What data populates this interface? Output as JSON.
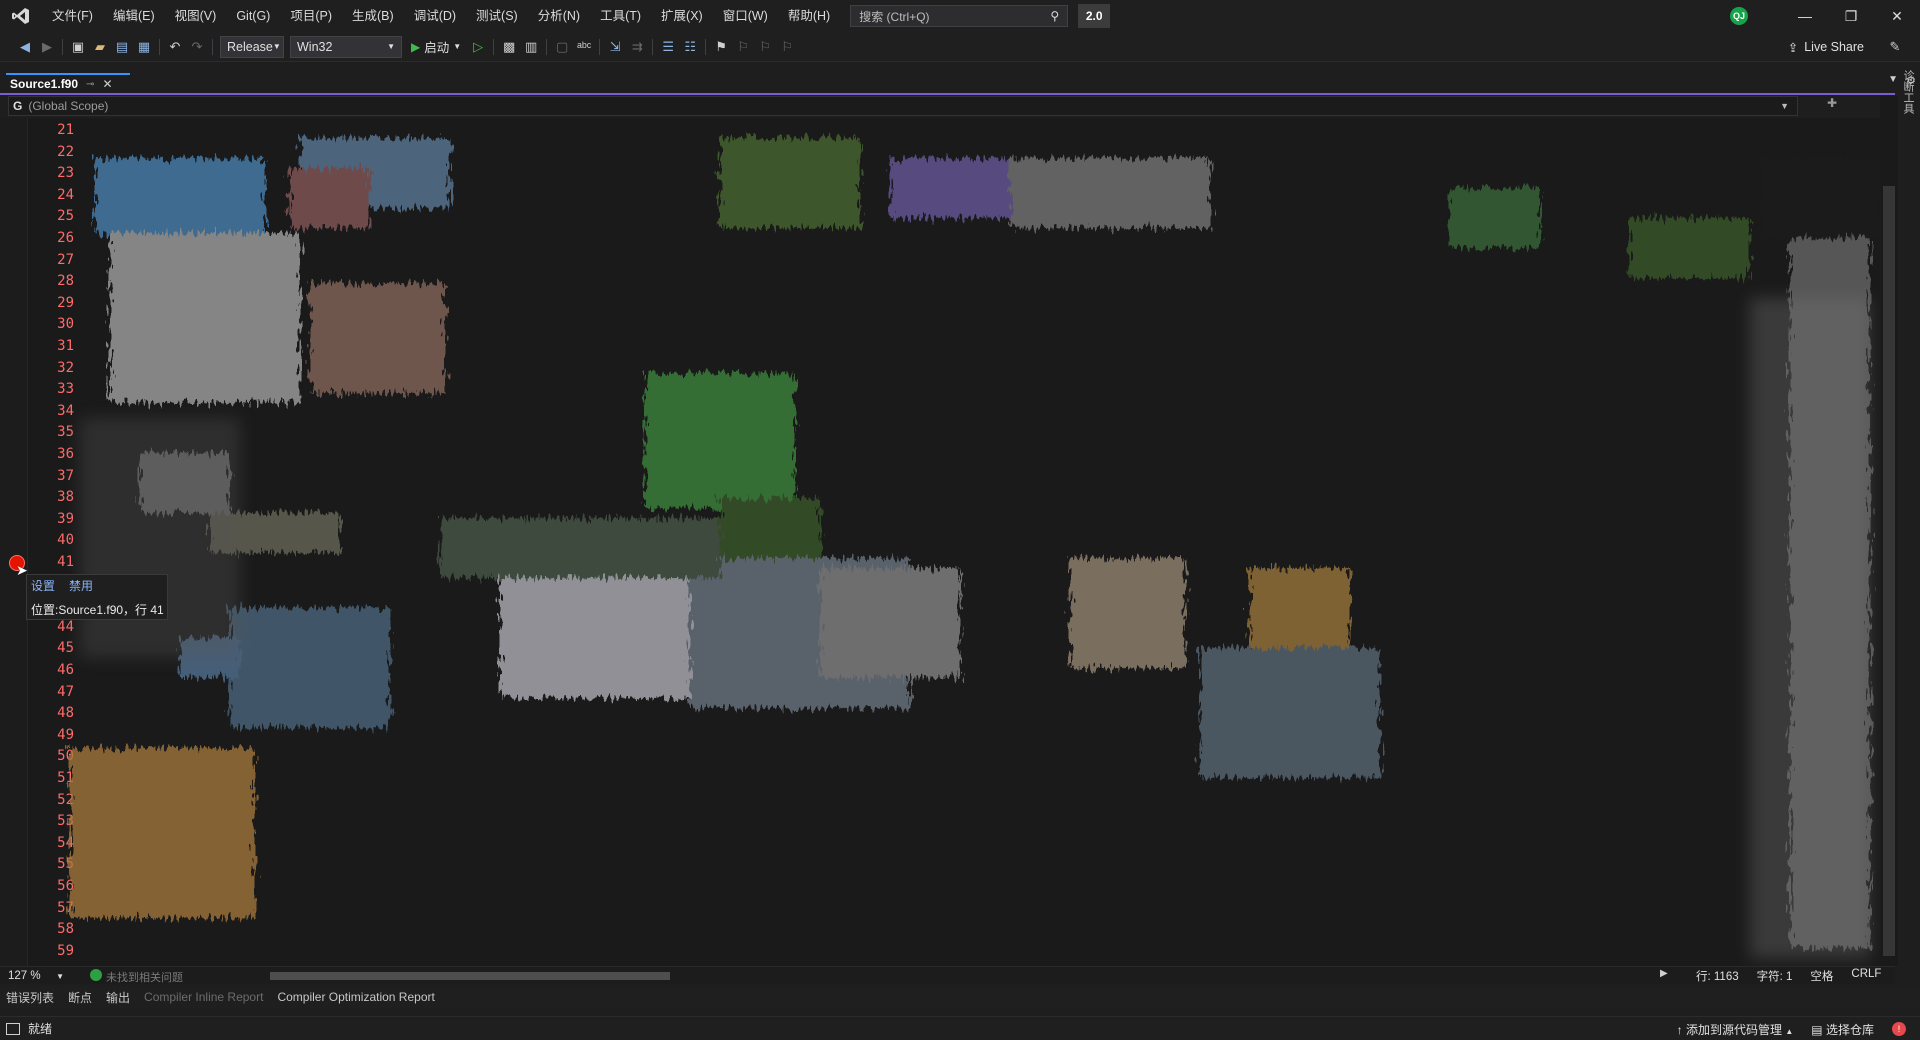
{
  "menubar": {
    "items": [
      "文件(F)",
      "编辑(E)",
      "视图(V)",
      "Git(G)",
      "项目(P)",
      "生成(B)",
      "调试(D)",
      "测试(S)",
      "分析(N)",
      "工具(T)",
      "扩展(X)",
      "窗口(W)",
      "帮助(H)"
    ],
    "search_placeholder": "搜索 (Ctrl+Q)",
    "version_badge": "2.0",
    "user_initials": "QJ"
  },
  "toolbar": {
    "configuration": "Release",
    "platform": "Win32",
    "start_label": "启动",
    "live_share_label": "Live Share"
  },
  "tab": {
    "title": "Source1.f90"
  },
  "navbar": {
    "prefix": "G",
    "scope": "(Global Scope)"
  },
  "editor": {
    "line_numbers": [
      "21",
      "22",
      "23",
      "24",
      "25",
      "26",
      "27",
      "28",
      "29",
      "30",
      "31",
      "32",
      "33",
      "34",
      "35",
      "36",
      "37",
      "38",
      "39",
      "40",
      "41",
      "42",
      "43",
      "44",
      "45",
      "46",
      "47",
      "48",
      "49",
      "50",
      "51",
      "52",
      "53",
      "54",
      "55",
      "56",
      "57",
      "58",
      "59"
    ],
    "line_number_color": "#ff6b6b",
    "breakpoint_color": "#e51400",
    "breakpoint_popup": {
      "settings_label": "设置",
      "disable_label": "禁用",
      "location": "位置:Source1.f90，行 41"
    }
  },
  "status_row": {
    "zoom": "127 %",
    "issues_text": "未找到相关问题",
    "line": "行: 1163",
    "char": "字符: 1",
    "indent": "空格",
    "eol": "CRLF"
  },
  "bottom_tabs": [
    "错误列表",
    "断点",
    "输出",
    "Compiler Inline Report",
    "Compiler Optimization Report"
  ],
  "statusbar": {
    "ready": "就绪",
    "source_control": "添加到源代码管理",
    "repo": "选择仓库"
  },
  "side_strip": {
    "label": "诊断工具"
  }
}
